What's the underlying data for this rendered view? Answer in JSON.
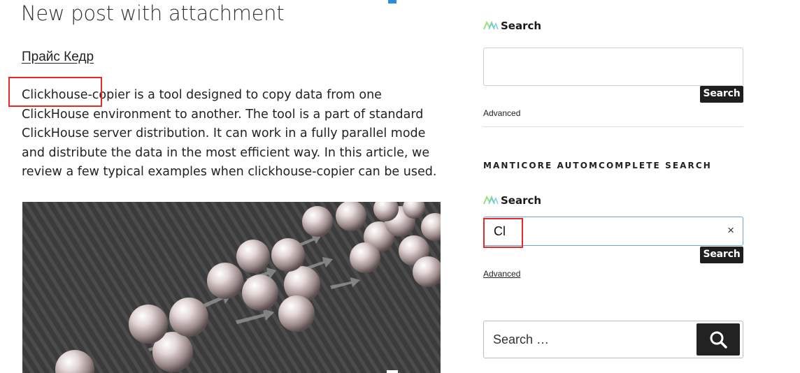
{
  "post": {
    "title": "New post with attachment",
    "author": "Прайс Кедр",
    "excerpt": "Clickhouse-copier is a tool designed to copy data from one ClickHouse environment to another. The tool is a part of standard ClickHouse server distribution. It can work in a fully parallel mode and distribute the data in the most efficient way. In this article, we review a few typical examples when clickhouse-copier can be used."
  },
  "sidebar": {
    "widget1": {
      "title": "Search",
      "input_value": "",
      "button_label": "Search",
      "advanced_label": "Advanced"
    },
    "section_heading": "Manticore automcomplete search",
    "widget2": {
      "title": "Search",
      "input_value": "Cl",
      "clear_label": "×",
      "button_label": "Search",
      "advanced_label": "Advanced"
    },
    "wp_search": {
      "placeholder": "Search …",
      "button_icon": "search-icon"
    }
  },
  "colors": {
    "highlight": "#e8282b",
    "button_dark": "#1e1e1e",
    "logo_green": "#9be07a",
    "active_border": "#6aa8d6"
  }
}
